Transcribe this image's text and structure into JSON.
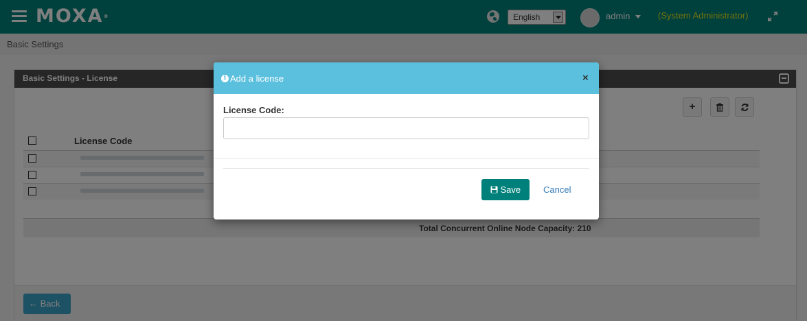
{
  "topbar": {
    "brand": "MOXA",
    "language": "English",
    "user": "admin",
    "role": "(System Administrator)"
  },
  "breadcrumb": "Basic Settings",
  "panel": {
    "title": "Basic Settings - License",
    "column_header": "License Code",
    "rows": [
      {
        "license_code": "",
        "checked": false
      },
      {
        "license_code": "",
        "checked": false
      },
      {
        "license_code": "",
        "checked": false
      }
    ],
    "total": "Total Concurrent Online Node Capacity: 210",
    "back_label": "Back"
  },
  "modal": {
    "title": "Add a license",
    "close_glyph": "×",
    "field_label": "License Code:",
    "field_value": "",
    "save_label": "Save",
    "cancel_label": "Cancel"
  },
  "colors": {
    "brand": "#00807a",
    "modal_header": "#5bc0de",
    "role_text": "#e3e31b",
    "link": "#337ab7"
  }
}
